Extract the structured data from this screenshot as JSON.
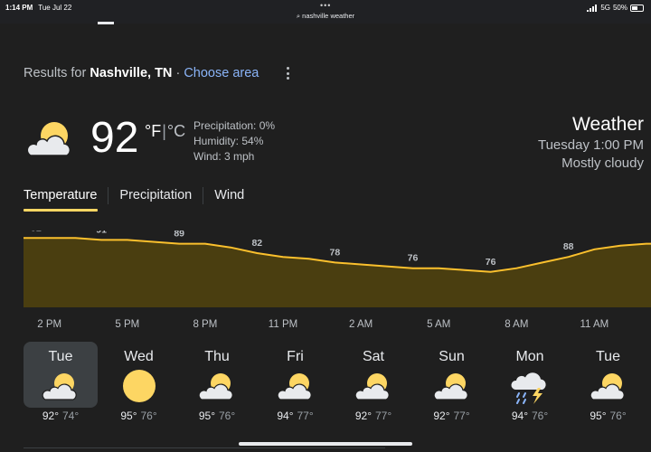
{
  "status": {
    "time": "1:14 PM",
    "date": "Tue Jul 22",
    "url": "nashville weather",
    "network": "5G",
    "battery": "50%",
    "battery_level": 0.5
  },
  "header": {
    "results_prefix": "Results for",
    "location": "Nashville, TN",
    "separator": "·",
    "choose": "Choose area"
  },
  "current": {
    "temp": "92",
    "unit_f": "°F",
    "unit_sep": "|",
    "unit_c": "°C",
    "precip": "Precipitation: 0%",
    "humidity": "Humidity: 54%",
    "wind": "Wind: 3 mph",
    "icon": "partly-cloudy-icon"
  },
  "weather_panel": {
    "title": "Weather",
    "time": "Tuesday 1:00 PM",
    "condition": "Mostly cloudy"
  },
  "tabs": [
    {
      "label": "Temperature"
    },
    {
      "label": "Precipitation"
    },
    {
      "label": "Wind"
    }
  ],
  "chart_data": {
    "type": "area",
    "x": [
      "1 PM",
      "2 PM",
      "3 PM",
      "4 PM",
      "5 PM",
      "6 PM",
      "7 PM",
      "8 PM",
      "9 PM",
      "10 PM",
      "11 PM",
      "12 AM",
      "1 AM",
      "2 AM",
      "3 AM",
      "4 AM",
      "5 AM",
      "6 AM",
      "7 AM",
      "8 AM",
      "9 AM",
      "10 AM",
      "11 AM",
      "12 PM",
      "1 PM"
    ],
    "values": [
      92,
      92,
      92,
      91,
      91,
      90,
      89,
      89,
      87,
      84,
      82,
      81,
      79,
      78,
      77,
      76,
      76,
      75,
      74,
      76,
      79,
      82,
      86,
      88,
      89
    ],
    "labels": [
      {
        "index": 0,
        "text": "92"
      },
      {
        "index": 3,
        "text": "91"
      },
      {
        "index": 6,
        "text": "89"
      },
      {
        "index": 9,
        "text": "82"
      },
      {
        "index": 12,
        "text": "78"
      },
      {
        "index": 15,
        "text": "76"
      },
      {
        "index": 18,
        "text": "76"
      },
      {
        "index": 21,
        "text": "88"
      }
    ],
    "xticks": [
      "2 PM",
      "5 PM",
      "8 PM",
      "11 PM",
      "2 AM",
      "5 AM",
      "8 AM",
      "11 AM"
    ],
    "ylim": [
      60,
      96
    ],
    "line_color": "#fbc02d",
    "fill_color": "#4a3e10"
  },
  "forecast": [
    {
      "day": "Tue",
      "hi": "92°",
      "lo": "74°",
      "icon": "partly-cloudy-icon"
    },
    {
      "day": "Wed",
      "hi": "95°",
      "lo": "76°",
      "icon": "sunny-icon"
    },
    {
      "day": "Thu",
      "hi": "95°",
      "lo": "76°",
      "icon": "partly-cloudy-icon"
    },
    {
      "day": "Fri",
      "hi": "94°",
      "lo": "77°",
      "icon": "partly-cloudy-icon"
    },
    {
      "day": "Sat",
      "hi": "92°",
      "lo": "77°",
      "icon": "partly-cloudy-icon"
    },
    {
      "day": "Sun",
      "hi": "92°",
      "lo": "77°",
      "icon": "partly-cloudy-icon"
    },
    {
      "day": "Mon",
      "hi": "94°",
      "lo": "76°",
      "icon": "thunderstorm-icon"
    },
    {
      "day": "Tue",
      "hi": "95°",
      "lo": "76°",
      "icon": "partly-cloudy-icon"
    }
  ]
}
